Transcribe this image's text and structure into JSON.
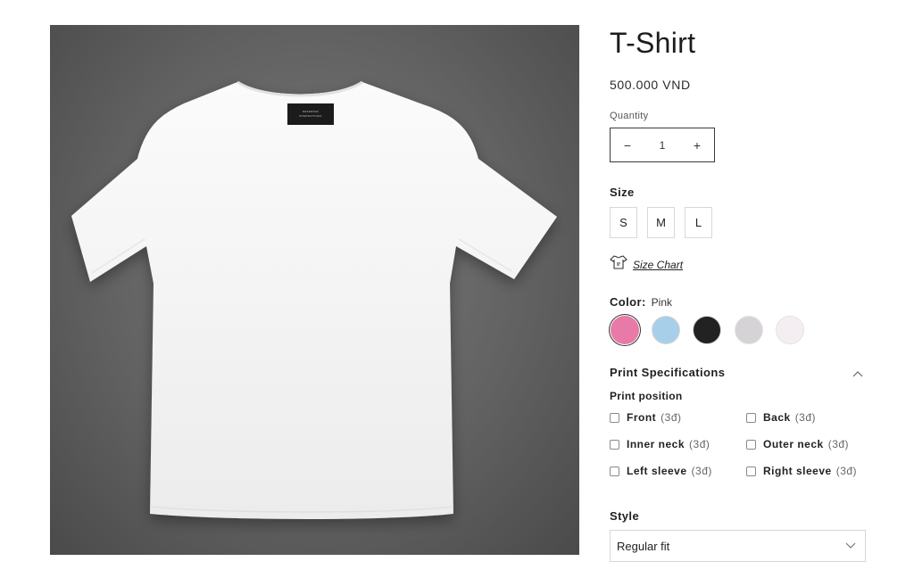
{
  "product": {
    "title": "T-Shirt",
    "price": "500.000 VND",
    "image_tag_line1": "RESERVED",
    "image_tag_line2": "INTERNATIONAL"
  },
  "quantity": {
    "label": "Quantity",
    "value": "1",
    "decrease": "−",
    "increase": "+"
  },
  "size": {
    "label": "Size",
    "options": [
      "S",
      "M",
      "L"
    ],
    "chart_link": "Size Chart"
  },
  "color": {
    "label": "Color:",
    "selected": "Pink",
    "swatches": [
      "#e77aa7",
      "#a8cfe9",
      "#222222",
      "#d6d3d6",
      "#f4eef3"
    ]
  },
  "print_specs": {
    "heading": "Print Specifications",
    "position_label": "Print position",
    "options": [
      {
        "name": "Front",
        "price": "(3đ)"
      },
      {
        "name": "Back",
        "price": "(3đ)"
      },
      {
        "name": "Inner neck",
        "price": "(3đ)"
      },
      {
        "name": "Outer neck",
        "price": "(3đ)"
      },
      {
        "name": "Left sleeve",
        "price": "(3đ)"
      },
      {
        "name": "Right sleeve",
        "price": "(3đ)"
      }
    ]
  },
  "style": {
    "label": "Style",
    "selected": "Regular fit"
  }
}
